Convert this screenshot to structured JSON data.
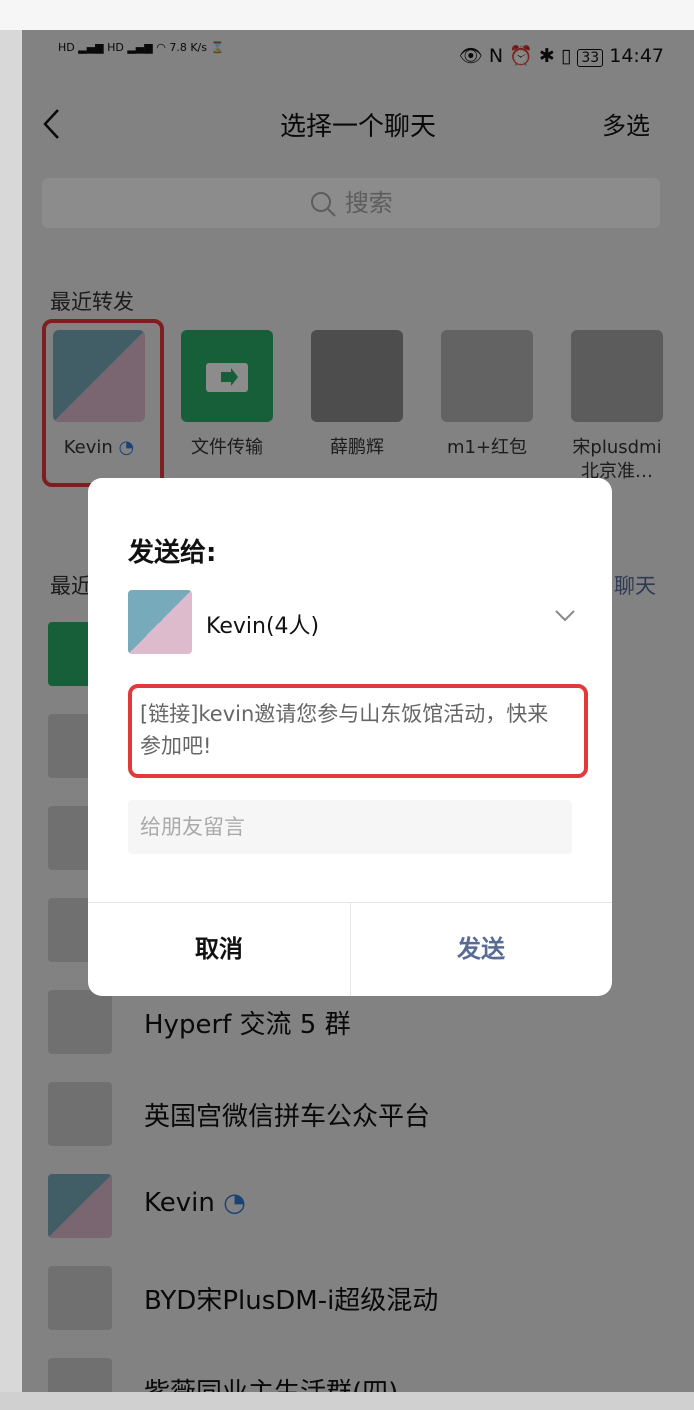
{
  "status": {
    "time": "14:47",
    "net_speed": "7.8",
    "net_unit": "K/s",
    "battery": "33"
  },
  "nav": {
    "title": "选择一个聊天",
    "multi": "多选"
  },
  "search": {
    "placeholder": "搜索"
  },
  "recent_forward": {
    "label": "最近转发",
    "items": [
      {
        "name": "Kevin"
      },
      {
        "name": "文件传输"
      },
      {
        "name": "薛鹏辉"
      },
      {
        "name": "m1+红包"
      },
      {
        "name": "宋plusdmi",
        "name2": "北京准…"
      }
    ]
  },
  "recent_chats_label": "最近",
  "recent_chats_right": "聊天",
  "chat_list": [
    {
      "name": "Hyperf 交流 5 群"
    },
    {
      "name": "英国宫微信拼车公众平台"
    },
    {
      "name": "Kevin"
    },
    {
      "name": "BYD宋PlusDM-i超级混动"
    },
    {
      "name": "紫薇同业主生活群(四)"
    }
  ],
  "dialog": {
    "title": "发送给:",
    "recipient": "Kevin(4人)",
    "message": "[链接]kevin邀请您参与山东饭馆活动，快来参加吧!",
    "comment_placeholder": "给朋友留言",
    "cancel": "取消",
    "send": "发送"
  },
  "colors": {
    "accent_blue": "#576b95",
    "highlight_red": "#e4393c",
    "wechat_green": "#2aae67"
  }
}
